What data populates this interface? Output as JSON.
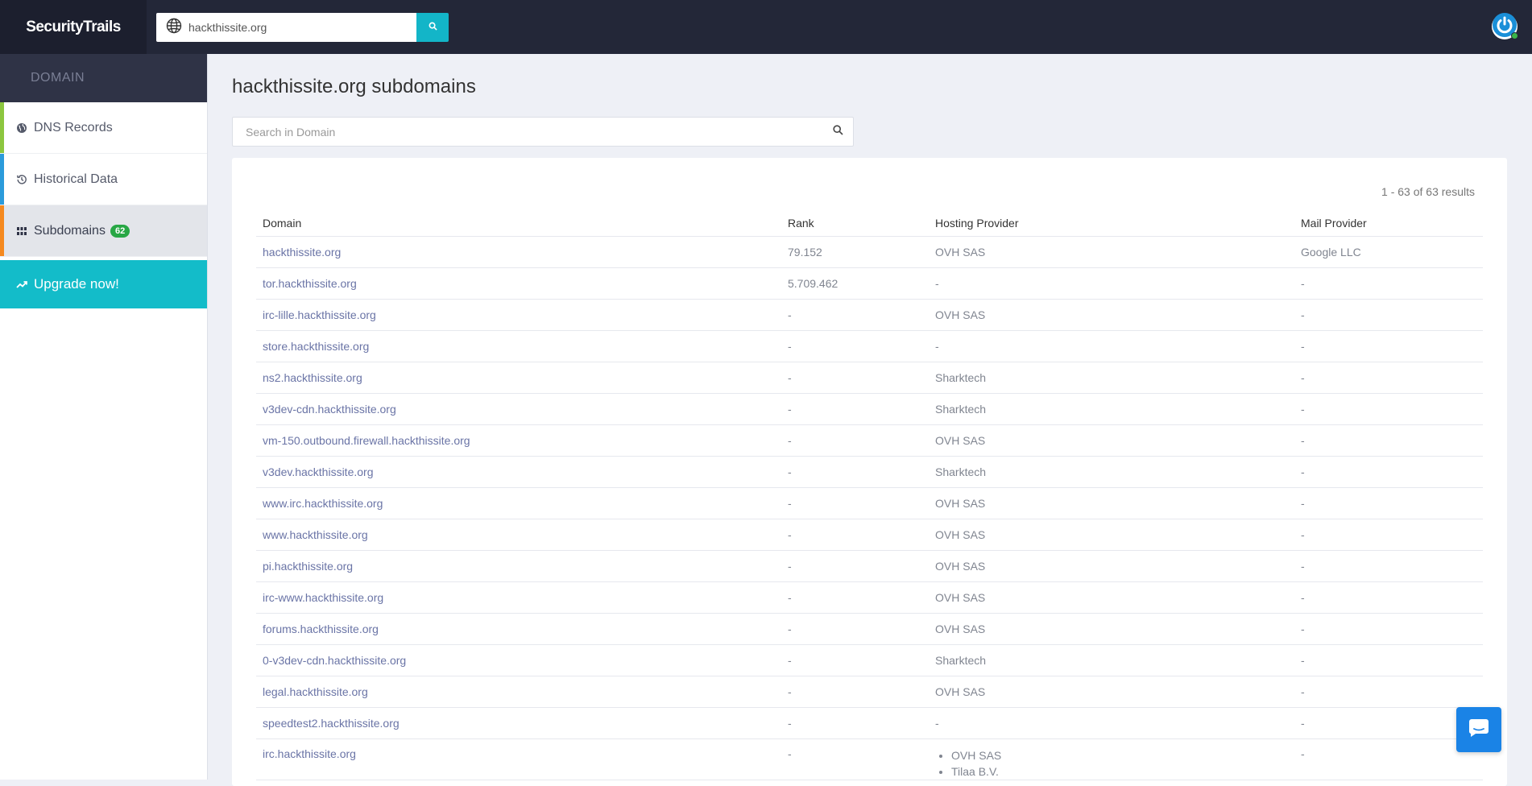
{
  "app": {
    "logo": "SecurityTrails"
  },
  "topbar": {
    "search_value": "hackthissite.org"
  },
  "sidebar": {
    "header": "DOMAIN",
    "items": [
      {
        "label": "DNS Records",
        "accent": "#8cc63f",
        "icon": "globe-icon"
      },
      {
        "label": "Historical Data",
        "accent": "#2b9bdb",
        "icon": "history-icon"
      },
      {
        "label": "Subdomains",
        "accent": "#f5891f",
        "icon": "grid-icon",
        "badge": "62"
      }
    ],
    "upgrade": "Upgrade now!"
  },
  "main": {
    "title": "hackthissite.org subdomains",
    "search_placeholder": "Search in Domain",
    "results": "1 - 63 of 63 results",
    "columns": [
      "Domain",
      "Rank",
      "Hosting Provider",
      "Mail Provider"
    ],
    "rows": [
      {
        "domain": "hackthissite.org",
        "rank": "79.152",
        "hosting": [
          "OVH SAS"
        ],
        "mail": "Google LLC"
      },
      {
        "domain": "tor.hackthissite.org",
        "rank": "5.709.462",
        "hosting": [
          "-"
        ],
        "mail": "-"
      },
      {
        "domain": "irc-lille.hackthissite.org",
        "rank": "-",
        "hosting": [
          "OVH SAS"
        ],
        "mail": "-"
      },
      {
        "domain": "store.hackthissite.org",
        "rank": "-",
        "hosting": [
          "-"
        ],
        "mail": "-"
      },
      {
        "domain": "ns2.hackthissite.org",
        "rank": "-",
        "hosting": [
          "Sharktech"
        ],
        "mail": "-"
      },
      {
        "domain": "v3dev-cdn.hackthissite.org",
        "rank": "-",
        "hosting": [
          "Sharktech"
        ],
        "mail": "-"
      },
      {
        "domain": "vm-150.outbound.firewall.hackthissite.org",
        "rank": "-",
        "hosting": [
          "OVH SAS"
        ],
        "mail": "-"
      },
      {
        "domain": "v3dev.hackthissite.org",
        "rank": "-",
        "hosting": [
          "Sharktech"
        ],
        "mail": "-"
      },
      {
        "domain": "www.irc.hackthissite.org",
        "rank": "-",
        "hosting": [
          "OVH SAS"
        ],
        "mail": "-"
      },
      {
        "domain": "www.hackthissite.org",
        "rank": "-",
        "hosting": [
          "OVH SAS"
        ],
        "mail": "-"
      },
      {
        "domain": "pi.hackthissite.org",
        "rank": "-",
        "hosting": [
          "OVH SAS"
        ],
        "mail": "-"
      },
      {
        "domain": "irc-www.hackthissite.org",
        "rank": "-",
        "hosting": [
          "OVH SAS"
        ],
        "mail": "-"
      },
      {
        "domain": "forums.hackthissite.org",
        "rank": "-",
        "hosting": [
          "OVH SAS"
        ],
        "mail": "-"
      },
      {
        "domain": "0-v3dev-cdn.hackthissite.org",
        "rank": "-",
        "hosting": [
          "Sharktech"
        ],
        "mail": "-"
      },
      {
        "domain": "legal.hackthissite.org",
        "rank": "-",
        "hosting": [
          "OVH SAS"
        ],
        "mail": "-"
      },
      {
        "domain": "speedtest2.hackthissite.org",
        "rank": "-",
        "hosting": [
          "-"
        ],
        "mail": "-"
      },
      {
        "domain": "irc.hackthissite.org",
        "rank": "-",
        "hosting": [
          "OVH SAS",
          "Tilaa B.V."
        ],
        "mail": "-"
      }
    ]
  },
  "colors": {
    "topbar": "#232738",
    "accent_teal": "#13bcc9",
    "link": "#6a74a6",
    "chat": "#1a83e6"
  }
}
